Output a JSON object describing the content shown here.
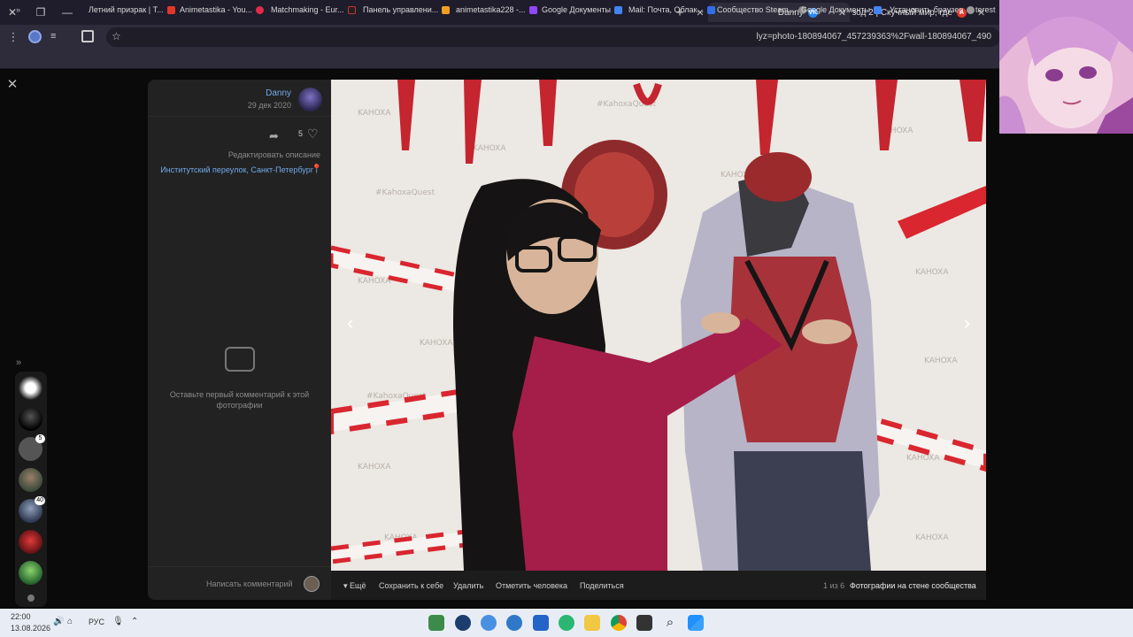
{
  "browser": {
    "tabs": [
      {
        "title": "Danny",
        "active": true
      },
      {
        "title": "Эпизод 2 | Скучный мир, где",
        "active": false
      }
    ],
    "url": "lyz=photo-180894067_457239363%2Fwall-180894067_490",
    "bookmarks": [
      "Летний призрак | Т...",
      "Animetastika - You...",
      "Matchmaking - Eur...",
      "Панель управлени...",
      "animetastika228 -...",
      "Google Документы",
      "Mail: Почта, Облак...",
      "Сообщество Steam...",
      "Google Документы",
      "Установить браузер",
      "terest"
    ]
  },
  "viewer": {
    "author_name": "Danny",
    "post_date": "29 дек 2020",
    "likes_count": "5",
    "edit_description": "Редактировать описание",
    "location": "Институтский переулок, Санкт-Петербург",
    "no_comments_text": "Оставьте первый комментарий к этой фотографии",
    "comment_placeholder": "Написать комментарий",
    "album_title": "Фотографии на стене сообщества",
    "counter": "1 из 6",
    "actions": {
      "share": "Поделиться",
      "tag_person": "Отметить человека",
      "delete": "Удалить",
      "save": "Сохранить к себе",
      "more": "Ещё"
    }
  },
  "rail": {
    "badges": [
      "5",
      "40"
    ]
  },
  "taskbar": {
    "time": "22:00",
    "date": "13.08.2026",
    "lang": "РУС"
  },
  "colors": {
    "accent_link": "#71aaeb",
    "tab_bg": "#1f1c2b",
    "toolbar_bg": "#2e2b3a",
    "taskbar_bg": "#e8edf5"
  }
}
